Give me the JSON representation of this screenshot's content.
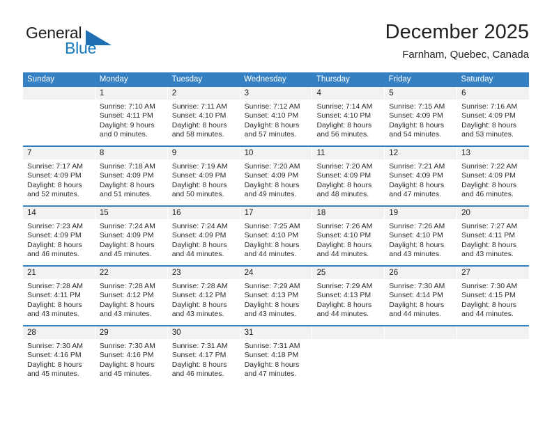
{
  "brand": {
    "name_line1": "General",
    "name_line2": "Blue",
    "accent_color": "#1277bc",
    "triangle_color": "#1f6eb4"
  },
  "header": {
    "title": "December 2025",
    "location": "Farnham, Quebec, Canada"
  },
  "theme": {
    "header_row_bg": "#3580c3",
    "daynum_band_bg": "#f2f2f2",
    "cell_bg": "#ffffff",
    "text_color": "#2b2b2b"
  },
  "weekdays": [
    "Sunday",
    "Monday",
    "Tuesday",
    "Wednesday",
    "Thursday",
    "Friday",
    "Saturday"
  ],
  "weeks": [
    [
      {
        "day": "",
        "lines": []
      },
      {
        "day": "1",
        "lines": [
          "Sunrise: 7:10 AM",
          "Sunset: 4:11 PM",
          "Daylight: 9 hours",
          "and 0 minutes."
        ]
      },
      {
        "day": "2",
        "lines": [
          "Sunrise: 7:11 AM",
          "Sunset: 4:10 PM",
          "Daylight: 8 hours",
          "and 58 minutes."
        ]
      },
      {
        "day": "3",
        "lines": [
          "Sunrise: 7:12 AM",
          "Sunset: 4:10 PM",
          "Daylight: 8 hours",
          "and 57 minutes."
        ]
      },
      {
        "day": "4",
        "lines": [
          "Sunrise: 7:14 AM",
          "Sunset: 4:10 PM",
          "Daylight: 8 hours",
          "and 56 minutes."
        ]
      },
      {
        "day": "5",
        "lines": [
          "Sunrise: 7:15 AM",
          "Sunset: 4:09 PM",
          "Daylight: 8 hours",
          "and 54 minutes."
        ]
      },
      {
        "day": "6",
        "lines": [
          "Sunrise: 7:16 AM",
          "Sunset: 4:09 PM",
          "Daylight: 8 hours",
          "and 53 minutes."
        ]
      }
    ],
    [
      {
        "day": "7",
        "lines": [
          "Sunrise: 7:17 AM",
          "Sunset: 4:09 PM",
          "Daylight: 8 hours",
          "and 52 minutes."
        ]
      },
      {
        "day": "8",
        "lines": [
          "Sunrise: 7:18 AM",
          "Sunset: 4:09 PM",
          "Daylight: 8 hours",
          "and 51 minutes."
        ]
      },
      {
        "day": "9",
        "lines": [
          "Sunrise: 7:19 AM",
          "Sunset: 4:09 PM",
          "Daylight: 8 hours",
          "and 50 minutes."
        ]
      },
      {
        "day": "10",
        "lines": [
          "Sunrise: 7:20 AM",
          "Sunset: 4:09 PM",
          "Daylight: 8 hours",
          "and 49 minutes."
        ]
      },
      {
        "day": "11",
        "lines": [
          "Sunrise: 7:20 AM",
          "Sunset: 4:09 PM",
          "Daylight: 8 hours",
          "and 48 minutes."
        ]
      },
      {
        "day": "12",
        "lines": [
          "Sunrise: 7:21 AM",
          "Sunset: 4:09 PM",
          "Daylight: 8 hours",
          "and 47 minutes."
        ]
      },
      {
        "day": "13",
        "lines": [
          "Sunrise: 7:22 AM",
          "Sunset: 4:09 PM",
          "Daylight: 8 hours",
          "and 46 minutes."
        ]
      }
    ],
    [
      {
        "day": "14",
        "lines": [
          "Sunrise: 7:23 AM",
          "Sunset: 4:09 PM",
          "Daylight: 8 hours",
          "and 46 minutes."
        ]
      },
      {
        "day": "15",
        "lines": [
          "Sunrise: 7:24 AM",
          "Sunset: 4:09 PM",
          "Daylight: 8 hours",
          "and 45 minutes."
        ]
      },
      {
        "day": "16",
        "lines": [
          "Sunrise: 7:24 AM",
          "Sunset: 4:09 PM",
          "Daylight: 8 hours",
          "and 44 minutes."
        ]
      },
      {
        "day": "17",
        "lines": [
          "Sunrise: 7:25 AM",
          "Sunset: 4:10 PM",
          "Daylight: 8 hours",
          "and 44 minutes."
        ]
      },
      {
        "day": "18",
        "lines": [
          "Sunrise: 7:26 AM",
          "Sunset: 4:10 PM",
          "Daylight: 8 hours",
          "and 44 minutes."
        ]
      },
      {
        "day": "19",
        "lines": [
          "Sunrise: 7:26 AM",
          "Sunset: 4:10 PM",
          "Daylight: 8 hours",
          "and 43 minutes."
        ]
      },
      {
        "day": "20",
        "lines": [
          "Sunrise: 7:27 AM",
          "Sunset: 4:11 PM",
          "Daylight: 8 hours",
          "and 43 minutes."
        ]
      }
    ],
    [
      {
        "day": "21",
        "lines": [
          "Sunrise: 7:28 AM",
          "Sunset: 4:11 PM",
          "Daylight: 8 hours",
          "and 43 minutes."
        ]
      },
      {
        "day": "22",
        "lines": [
          "Sunrise: 7:28 AM",
          "Sunset: 4:12 PM",
          "Daylight: 8 hours",
          "and 43 minutes."
        ]
      },
      {
        "day": "23",
        "lines": [
          "Sunrise: 7:28 AM",
          "Sunset: 4:12 PM",
          "Daylight: 8 hours",
          "and 43 minutes."
        ]
      },
      {
        "day": "24",
        "lines": [
          "Sunrise: 7:29 AM",
          "Sunset: 4:13 PM",
          "Daylight: 8 hours",
          "and 43 minutes."
        ]
      },
      {
        "day": "25",
        "lines": [
          "Sunrise: 7:29 AM",
          "Sunset: 4:13 PM",
          "Daylight: 8 hours",
          "and 44 minutes."
        ]
      },
      {
        "day": "26",
        "lines": [
          "Sunrise: 7:30 AM",
          "Sunset: 4:14 PM",
          "Daylight: 8 hours",
          "and 44 minutes."
        ]
      },
      {
        "day": "27",
        "lines": [
          "Sunrise: 7:30 AM",
          "Sunset: 4:15 PM",
          "Daylight: 8 hours",
          "and 44 minutes."
        ]
      }
    ],
    [
      {
        "day": "28",
        "lines": [
          "Sunrise: 7:30 AM",
          "Sunset: 4:16 PM",
          "Daylight: 8 hours",
          "and 45 minutes."
        ]
      },
      {
        "day": "29",
        "lines": [
          "Sunrise: 7:30 AM",
          "Sunset: 4:16 PM",
          "Daylight: 8 hours",
          "and 45 minutes."
        ]
      },
      {
        "day": "30",
        "lines": [
          "Sunrise: 7:31 AM",
          "Sunset: 4:17 PM",
          "Daylight: 8 hours",
          "and 46 minutes."
        ]
      },
      {
        "day": "31",
        "lines": [
          "Sunrise: 7:31 AM",
          "Sunset: 4:18 PM",
          "Daylight: 8 hours",
          "and 47 minutes."
        ]
      },
      {
        "day": "",
        "lines": []
      },
      {
        "day": "",
        "lines": []
      },
      {
        "day": "",
        "lines": []
      }
    ]
  ]
}
